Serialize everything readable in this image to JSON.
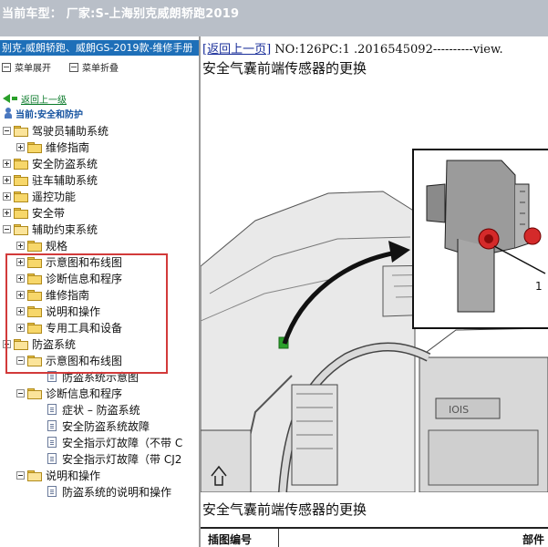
{
  "window": {
    "title": "当前车型：  厂家:S-上海别克威朗轿跑2019"
  },
  "sidebar": {
    "header": "别克-威朗轿跑、威朗GS-2019款-维修手册",
    "toolbar": {
      "expand_label": "菜单展开",
      "collapse_label": "菜单折叠"
    },
    "back_label": "返回上一级",
    "current_label": "当前:安全和防护",
    "items": [
      {
        "label": "驾驶员辅助系统"
      },
      {
        "label": "维修指南"
      },
      {
        "label": "安全防盗系统"
      },
      {
        "label": "驻车辅助系统"
      },
      {
        "label": "遥控功能"
      },
      {
        "label": "安全带"
      },
      {
        "label": "辅助约束系统"
      },
      {
        "label": "规格"
      },
      {
        "label": "示意图和布线图"
      },
      {
        "label": "诊断信息和程序"
      },
      {
        "label": "维修指南"
      },
      {
        "label": "说明和操作"
      },
      {
        "label": "专用工具和设备"
      },
      {
        "label": "防盗系统"
      },
      {
        "label": "示意图和布线图"
      },
      {
        "label": "防盗系统示意图"
      },
      {
        "label": "诊断信息和程序"
      },
      {
        "label": "症状 – 防盗系统"
      },
      {
        "label": "安全防盗系统故障"
      },
      {
        "label": "安全指示灯故障（不带 C"
      },
      {
        "label": "安全指示灯故障（带 CJ2"
      },
      {
        "label": "说明和操作"
      },
      {
        "label": "防盗系统的说明和操作"
      }
    ]
  },
  "content": {
    "nav_link": "[返回上一页]",
    "nav_rest": " NO:126PC:1 .2016545092----------view.",
    "title": "安全气囊前端传感器的更换",
    "section_title": "安全气囊前端传感器的更换",
    "callout_number": "1",
    "table": {
      "col1": "插图编号",
      "col2": "部件"
    }
  },
  "colors": {
    "header_blue": "#1e6fb8",
    "highlight_red": "#d23a3a",
    "link_blue": "#1a2f9a",
    "back_green": "#0a7a2a"
  }
}
